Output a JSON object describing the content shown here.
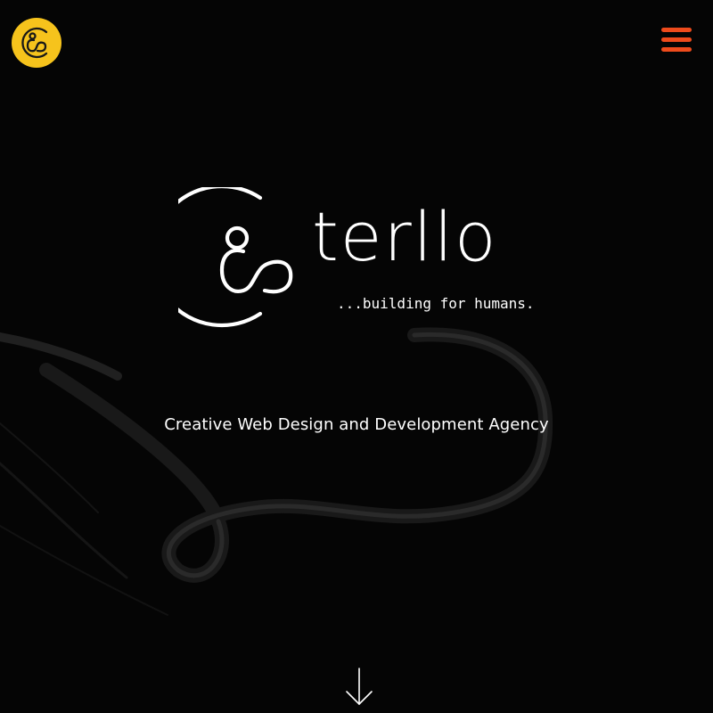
{
  "header": {
    "badge_logo_icon": "cc-monogram-icon",
    "menu_icon": "hamburger-menu-icon"
  },
  "hero": {
    "brand_name": "terllo",
    "tagline": "...building for humans.",
    "subtitle": "Creative Web Design and Development Agency",
    "scroll_icon": "arrow-down-icon"
  },
  "colors": {
    "background": "#050505",
    "badge": "#f6c31c",
    "menu": "#ee4b1c",
    "text": "#ffffff"
  }
}
